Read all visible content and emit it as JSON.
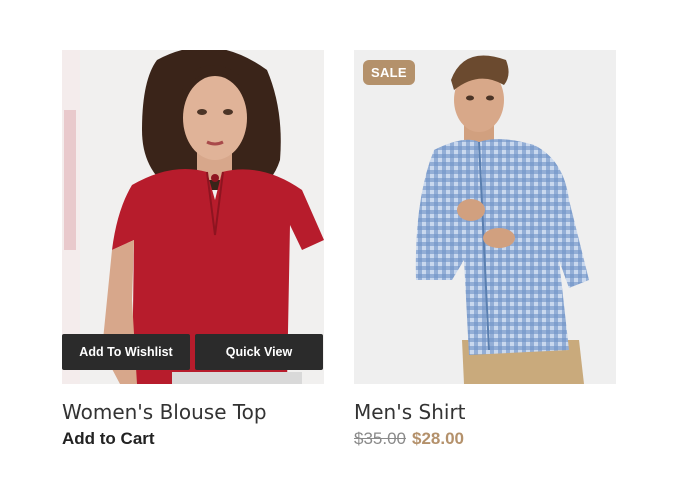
{
  "products": [
    {
      "title": "Women's Blouse Top",
      "add_to_cart": "Add to Cart",
      "actions": {
        "wishlist": "Add To Wishlist",
        "quick_view": "Quick View"
      },
      "image": "woman-red-blouse"
    },
    {
      "title": "Men's Shirt",
      "badge": "SALE",
      "old_price": "$35.00",
      "new_price": "$28.00",
      "image": "man-blue-gingham-shirt"
    }
  ],
  "colors": {
    "accent": "#b4916b",
    "button_bg": "#2b2b2b",
    "blouse_red": "#b71c2c",
    "shirt_blue": "#6f93c6"
  }
}
